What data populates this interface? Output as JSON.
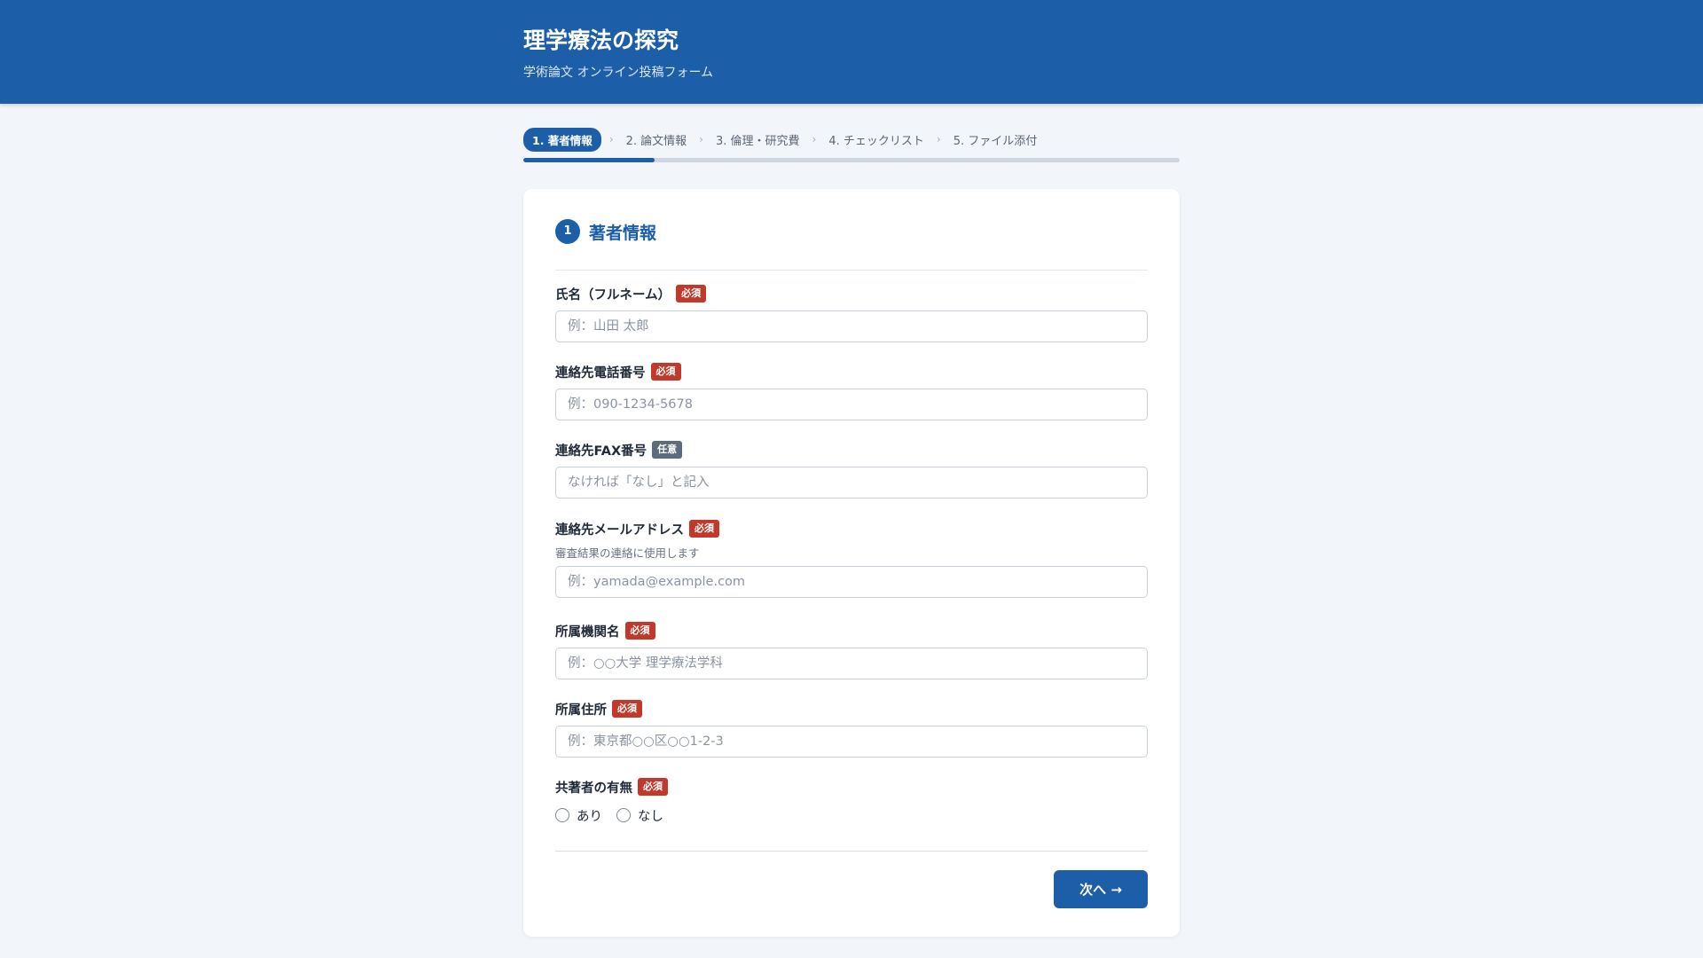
{
  "header": {
    "title": "理学療法の探究",
    "subtitle": "学術論文 オンライン投稿フォーム"
  },
  "steps": [
    {
      "label": "1. 著者情報",
      "active": true
    },
    {
      "label": "2. 論文情報",
      "active": false
    },
    {
      "label": "3. 倫理・研究費",
      "active": false
    },
    {
      "label": "4. チェックリスト",
      "active": false
    },
    {
      "label": "5. ファイル添付",
      "active": false
    }
  ],
  "progress": 0.2,
  "section": {
    "number": "1",
    "title": "著者情報"
  },
  "badges": {
    "required": "必須",
    "optional": "任意"
  },
  "fields": {
    "name": {
      "label": "氏名（フルネーム）",
      "placeholder": "例：山田 太郎",
      "value": ""
    },
    "phone": {
      "label": "連絡先電話番号",
      "placeholder": "例：090-1234-5678",
      "value": ""
    },
    "fax": {
      "label": "連絡先FAX番号",
      "placeholder": "なければ「なし」と記入",
      "value": ""
    },
    "email": {
      "label": "連絡先メールアドレス",
      "hint": "審査結果の連絡に使用します",
      "placeholder": "例：yamada@example.com",
      "value": ""
    },
    "affiliation": {
      "label": "所属機関名",
      "placeholder": "例：○○大学 理学療法学科",
      "value": ""
    },
    "address": {
      "label": "所属住所",
      "placeholder": "例：東京都○○区○○1-2-3",
      "value": ""
    },
    "coauthor": {
      "label": "共著者の有無",
      "options": [
        "あり",
        "なし"
      ],
      "selected": null
    }
  },
  "next_button": "次へ →",
  "colors": {
    "primary": "#1c5ea8",
    "required_badge": "#c0392b",
    "optional_badge": "#5e6b7d",
    "background": "#f2f5f9"
  }
}
